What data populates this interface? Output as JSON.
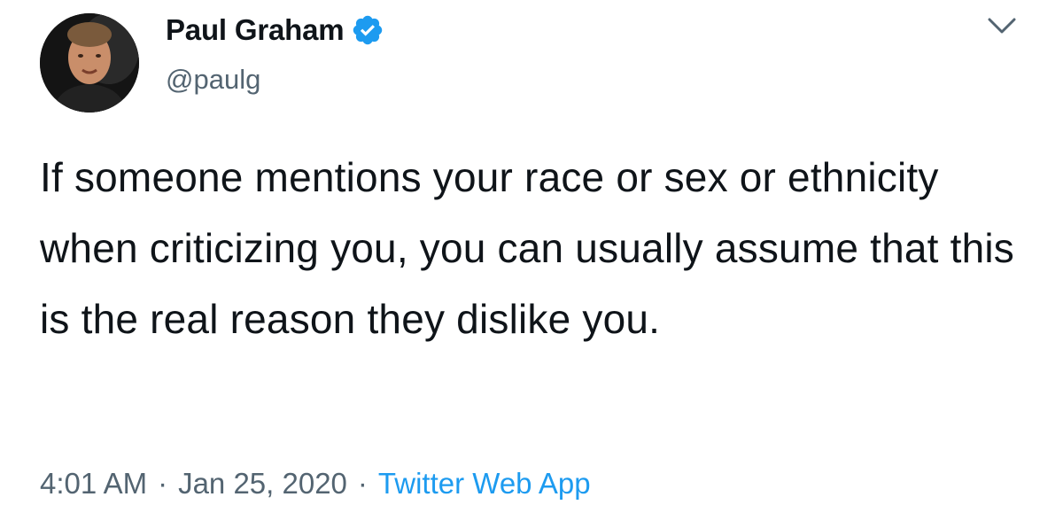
{
  "author": {
    "display_name": "Paul Graham",
    "handle": "@paulg",
    "verified": true,
    "verified_icon": "verified-badge-icon",
    "avatar": "profile-photo"
  },
  "menu": {
    "icon": "chevron-down-icon"
  },
  "tweet": {
    "text": "If someone mentions your race or sex or ethnicity when criticizing you, you can usually assume that this is the real reason they dislike you."
  },
  "meta": {
    "time": "4:01 AM",
    "separator": "·",
    "date": "Jan 25, 2020",
    "source": "Twitter Web App"
  },
  "colors": {
    "text": "#0f1419",
    "secondary": "#536471",
    "accent": "#1d9bf0",
    "background": "#ffffff"
  }
}
